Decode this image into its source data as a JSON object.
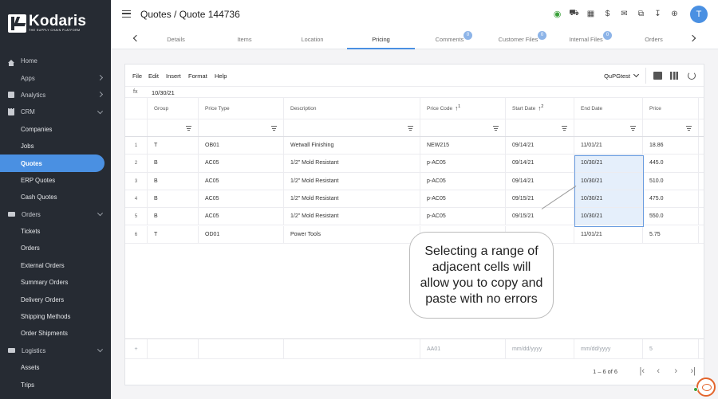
{
  "brand": {
    "name": "Kodaris",
    "tagline": "THE SUPPLY CHAIN PLATFORM"
  },
  "sidebar": {
    "items": [
      {
        "label": "Home",
        "icon": "home-icon"
      },
      {
        "label": "Apps",
        "icon": "grid-icon"
      },
      {
        "label": "Analytics",
        "icon": "chart-icon"
      },
      {
        "label": "CRM",
        "icon": "crm-icon"
      },
      {
        "label": "Companies"
      },
      {
        "label": "Jobs"
      },
      {
        "label": "Quotes"
      },
      {
        "label": "ERP Quotes"
      },
      {
        "label": "Cash Quotes"
      },
      {
        "label": "Orders",
        "icon": "truck-icon"
      },
      {
        "label": "Tickets"
      },
      {
        "label": "Orders"
      },
      {
        "label": "External Orders"
      },
      {
        "label": "Summary Orders"
      },
      {
        "label": "Delivery Orders"
      },
      {
        "label": "Shipping Methods"
      },
      {
        "label": "Order Shipments"
      },
      {
        "label": "Logistics",
        "icon": "truck-icon"
      },
      {
        "label": "Assets"
      },
      {
        "label": "Trips"
      }
    ]
  },
  "header": {
    "title": "Quotes / Quote 144736",
    "avatar": "T"
  },
  "tabs": [
    {
      "label": "Details"
    },
    {
      "label": "Items"
    },
    {
      "label": "Location"
    },
    {
      "label": "Pricing"
    },
    {
      "label": "Comments",
      "badge": "0"
    },
    {
      "label": "Customer Files",
      "badge": "0"
    },
    {
      "label": "Internal Files",
      "badge": "0"
    },
    {
      "label": "Orders"
    }
  ],
  "toolbar": {
    "file": "File",
    "edit": "Edit",
    "insert": "Insert",
    "format": "Format",
    "help": "Help",
    "preset": "QuPGtest"
  },
  "formula": {
    "label": "fx",
    "value": "10/30/21"
  },
  "table": {
    "columns": [
      "Group",
      "Price Type",
      "Description",
      "Price Code",
      "Start Date",
      "End Date",
      "Price"
    ],
    "sort": {
      "price_code": "1",
      "start_date": "2"
    },
    "rows": [
      {
        "n": "1",
        "group": "T",
        "type": "OB01",
        "desc": "Wetwall Finishing",
        "code": "NEW215",
        "start": "09/14/21",
        "end": "11/01/21",
        "price": "18.86"
      },
      {
        "n": "2",
        "group": "B",
        "type": "AC05",
        "desc": "1/2\" Mold Resistant",
        "code": "p-AC05",
        "start": "09/14/21",
        "end": "10/30/21",
        "price": "445.0"
      },
      {
        "n": "3",
        "group": "B",
        "type": "AC05",
        "desc": "1/2\" Mold Resistant",
        "code": "p-AC05",
        "start": "09/14/21",
        "end": "10/30/21",
        "price": "510.0"
      },
      {
        "n": "4",
        "group": "B",
        "type": "AC05",
        "desc": "1/2\" Mold Resistant",
        "code": "p-AC05",
        "start": "09/15/21",
        "end": "10/30/21",
        "price": "475.0"
      },
      {
        "n": "5",
        "group": "B",
        "type": "AC05",
        "desc": "1/2\" Mold Resistant",
        "code": "p-AC05",
        "start": "09/15/21",
        "end": "10/30/21",
        "price": "550.0"
      },
      {
        "n": "6",
        "group": "T",
        "type": "OD01",
        "desc": "Power Tools",
        "code": "",
        "start": "",
        "end": "11/01/21",
        "price": "5.75"
      }
    ],
    "new_row": {
      "code": "AA01",
      "start": "mm/dd/yyyy",
      "end": "mm/dd/yyyy",
      "price": "5"
    },
    "pager": "1 – 6 of 6"
  },
  "callout": "Selecting a range of adjacent cells will allow you to copy and paste with no errors",
  "colors": {
    "sidebar": "#262b33",
    "accent": "#4a90e2",
    "selection": "#e5effb"
  }
}
